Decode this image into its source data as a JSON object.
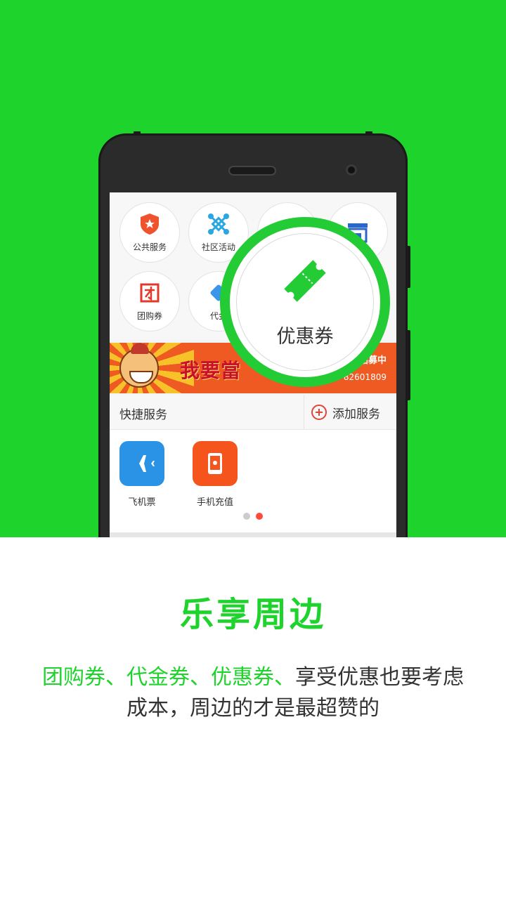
{
  "colors": {
    "brand_green": "#1ed42c",
    "accent_red": "#ff4a3a",
    "text_dark": "#333333"
  },
  "grid": {
    "items": [
      {
        "label": "公共服务",
        "icon": "badge-icon"
      },
      {
        "label": "社区活动",
        "icon": "network-icon"
      },
      {
        "label": "",
        "icon": "heart-icon"
      },
      {
        "label": "",
        "icon": "storefront-icon"
      },
      {
        "label": "团购券",
        "icon": "tuan-icon"
      },
      {
        "label": "代金",
        "icon": "voucher-icon"
      }
    ]
  },
  "banner": {
    "slogan": "我要當",
    "recruit": "招募中",
    "phone": "联系电话：010-82601809"
  },
  "quick": {
    "title": "快捷服务",
    "add_label": "添加服务",
    "apps": [
      {
        "name": "飞机票",
        "icon": "airplane-icon",
        "color": "#2a93e6"
      },
      {
        "name": "手机充值",
        "icon": "phone-recharge-icon",
        "color": "#f5541d"
      }
    ],
    "page_count": 2,
    "active_page": 2
  },
  "magnifier": {
    "label": "优惠券",
    "icon": "ticket-icon"
  },
  "headline": "乐享周边",
  "description": {
    "highlight": "团购券、代金券、优惠券、",
    "rest_line1": "享受优惠也要考虑",
    "rest_line2": "成本，周边的才是最超赞的"
  }
}
